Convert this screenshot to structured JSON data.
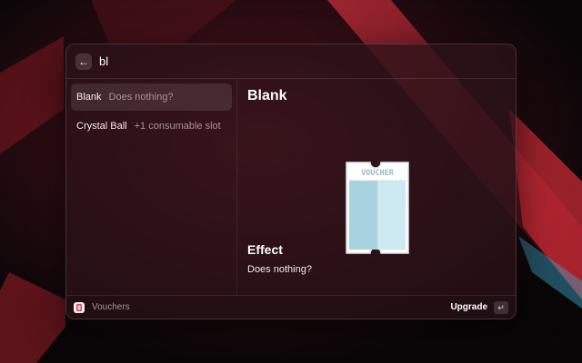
{
  "search": {
    "query": "bl",
    "back_icon": "arrow-left-icon"
  },
  "results": [
    {
      "title": "Blank",
      "subtitle": "Does nothing?",
      "selected": true
    },
    {
      "title": "Crystal Ball",
      "subtitle": "+1 consumable slot",
      "selected": false
    }
  ],
  "detail": {
    "title": "Blank",
    "image": {
      "icon": "voucher-ticket-icon",
      "label": "VOUCHER"
    },
    "effect_heading": "Effect",
    "effect_text": "Does nothing?"
  },
  "footer": {
    "extension_icon": "voucher-extension-icon",
    "extension_name": "Vouchers",
    "action_label": "Upgrade",
    "enter_symbol": "↵"
  },
  "colors": {
    "window_tint": "#2a1218",
    "voucher_body": "#cde9f2",
    "voucher_shade": "#a9d2df",
    "voucher_text": "#9fb8c4"
  }
}
